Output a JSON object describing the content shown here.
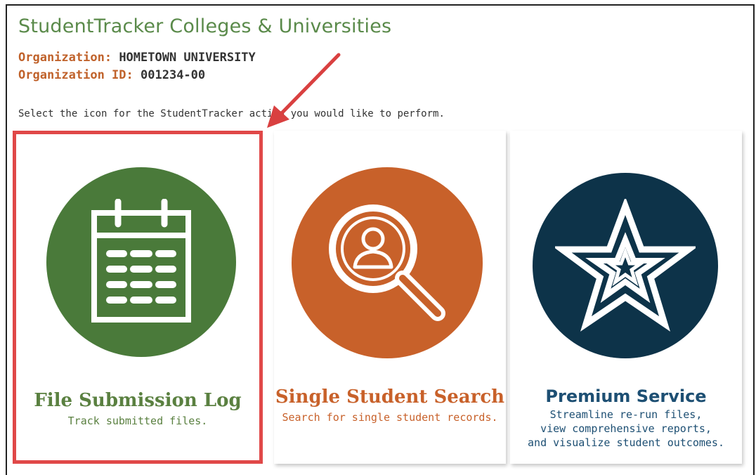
{
  "header": {
    "app_title": "StudentTracker Colleges & Universities",
    "org_label": "Organization:",
    "org_value": "HOMETOWN UNIVERSITY",
    "orgid_label": "Organization ID:",
    "orgid_value": "001234-00"
  },
  "instruction": "Select the icon for the StudentTracker action you would like to perform.",
  "tiles": [
    {
      "title": "File Submission Log",
      "subtitle": "Track submitted files.",
      "icon": "calendar-icon",
      "circle_color": "#4a7a3a",
      "title_color": "#5a8040",
      "sub_color": "#5a8040",
      "selected": true
    },
    {
      "title": "Single Student Search",
      "subtitle": "Search for single student records.",
      "icon": "student-search-icon",
      "circle_color": "#c8612a",
      "title_color": "#c8612a",
      "sub_color": "#c8612a",
      "selected": false
    },
    {
      "title": "Premium Service",
      "subtitle_lines": [
        "Streamline re-run files,",
        "view comprehensive reports,",
        "and visualize student outcomes."
      ],
      "icon": "star-icon",
      "circle_color": "#0d3349",
      "title_color": "#1d4f73",
      "sub_color": "#1d4f73",
      "selected": false
    }
  ],
  "colors": {
    "highlight_box": "#e04848",
    "arrow": "#d94040"
  }
}
